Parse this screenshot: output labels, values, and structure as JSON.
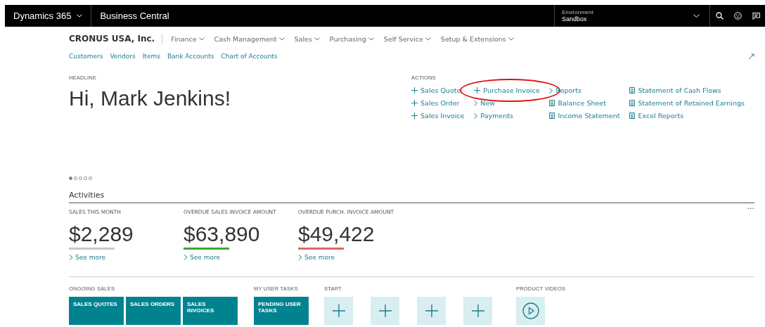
{
  "top_bar": {
    "product": "Dynamics 365",
    "app": "Business Central",
    "environment_label": "Environment",
    "environment": "Sandbox"
  },
  "company": "CRONUS USA, Inc.",
  "menus": [
    "Finance",
    "Cash Management",
    "Sales",
    "Purchasing",
    "Self Service",
    "Setup & Extensions"
  ],
  "links": [
    "Customers",
    "Vendors",
    "Items",
    "Bank Accounts",
    "Chart of Accounts"
  ],
  "headline": {
    "label": "HEADLINE",
    "text": "Hi, Mark Jenkins!",
    "pages": [
      {
        "selected": true
      },
      {
        "selected": false
      },
      {
        "selected": false
      },
      {
        "selected": false
      },
      {
        "selected": false
      }
    ]
  },
  "actions": {
    "label": "ACTIONS",
    "columns": [
      [
        {
          "kind": "new",
          "label": "Sales Quote",
          "circled": false
        },
        {
          "kind": "new",
          "label": "Sales Order",
          "circled": false
        },
        {
          "kind": "new",
          "label": "Sales Invoice",
          "circled": false
        }
      ],
      [
        {
          "kind": "new",
          "label": "Purchase Invoice",
          "circled": true
        },
        {
          "kind": "menu",
          "label": "New",
          "circled": false
        },
        {
          "kind": "menu",
          "label": "Payments",
          "circled": false
        }
      ],
      [
        {
          "kind": "menu",
          "label": "Reports",
          "circled": false
        },
        {
          "kind": "report",
          "label": "Balance Sheet",
          "circled": false
        },
        {
          "kind": "report",
          "label": "Income Statement",
          "circled": false
        }
      ],
      [
        {
          "kind": "report",
          "label": "Statement of Cash Flows",
          "circled": false
        },
        {
          "kind": "report",
          "label": "Statement of Retained Earnings",
          "circled": false
        },
        {
          "kind": "report",
          "label": "Excel Reports",
          "circled": false
        }
      ]
    ]
  },
  "activities": {
    "title": "Activities",
    "more": "...",
    "cues": [
      {
        "label": "SALES THIS MONTH",
        "value": "$2,289",
        "color": "#c8c8c8",
        "link": "See more"
      },
      {
        "label": "OVERDUE SALES INVOICE AMOUNT",
        "value": "$63,890",
        "color": "#3aa935",
        "link": "See more"
      },
      {
        "label": "OVERDUE PURCH. INVOICE AMOUNT",
        "value": "$49,422",
        "color": "#e06666",
        "link": "See more"
      }
    ]
  },
  "tile_groups": [
    {
      "label": "ONGOING SALES",
      "tiles": [
        {
          "kind": "cue",
          "label": "SALES QUOTES"
        },
        {
          "kind": "cue",
          "label": "SALES ORDERS"
        },
        {
          "kind": "cue",
          "label": "SALES INVOICES"
        }
      ]
    },
    {
      "label": "MY USER TASKS",
      "tiles": [
        {
          "kind": "cue",
          "label": "PENDING USER TASKS"
        }
      ]
    },
    {
      "label": "START",
      "tiles": [
        {
          "kind": "add"
        },
        {
          "kind": "add"
        },
        {
          "kind": "add"
        },
        {
          "kind": "add"
        }
      ]
    },
    {
      "label": "PRODUCT VIDEOS",
      "tiles": [
        {
          "kind": "video"
        }
      ]
    }
  ]
}
